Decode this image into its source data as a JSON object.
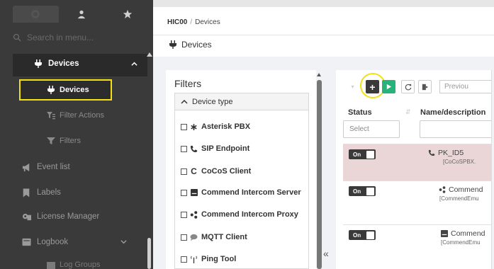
{
  "sidebar": {
    "search_placeholder": "Search in menu...",
    "devices_group": "Devices",
    "devices_sub": "Devices",
    "filter_actions": "Filter Actions",
    "filters": "Filters",
    "event_list": "Event list",
    "labels": "Labels",
    "license_manager": "License Manager",
    "logbook": "Logbook",
    "log_groups": "Log Groups"
  },
  "breadcrumb": {
    "root": "HIC00",
    "separator": "/",
    "current": "Devices"
  },
  "page_title": "Devices",
  "filters": {
    "title": "Filters",
    "section": "Device type",
    "items": [
      "Asterisk PBX",
      "SIP Endpoint",
      "CoCoS Client",
      "Commend Intercom Server",
      "Commend Intercom Proxy",
      "MQTT Client",
      "Ping Tool"
    ]
  },
  "collapse_label": "«",
  "toolbar": {
    "add_label": "+",
    "prev_label": "Previou"
  },
  "table": {
    "col_status": "Status",
    "col_name": "Name/description",
    "status_filter": "Select",
    "rows": [
      {
        "toggle": "On",
        "name": "PK_ID5",
        "sub": "[CoCoSPBX.",
        "highlighted": true
      },
      {
        "toggle": "On",
        "name": "Commend",
        "sub": "[CommendEmu",
        "highlighted": false
      },
      {
        "toggle": "On",
        "name": "Commend",
        "sub": "[CommendEmu",
        "highlighted": false
      }
    ]
  },
  "colors": {
    "sidebar_bg": "#3a3a3a",
    "highlight": "#f2e017",
    "play_green": "#27b37a",
    "row_highlight": "#ead6d6"
  }
}
